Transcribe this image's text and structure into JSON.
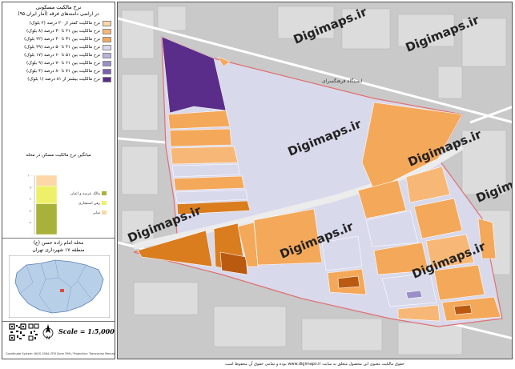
{
  "legend": {
    "title": "نرخ مالکیت مسکونی",
    "subtitle": "در اراضی دامنه‌های فرقه (آمار ایران ۹۵)",
    "classes": [
      {
        "label": "نرخ مالکیت کمتر از ۲۰ درصد (۲ بلوک)",
        "color": "#fcd8a8"
      },
      {
        "label": "نرخ مالکیت بین ۲۱ تا ۳۰ درصد (۸ بلوک)",
        "color": "#f7b877"
      },
      {
        "label": "نرخ مالکیت بین ۳۱ تا ۴۰ درصد (۲۲ بلوک)",
        "color": "#f4a85a"
      },
      {
        "label": "نرخ مالکیت بین ۴۱ تا ۵۰ درصد (۲۹ بلوک)",
        "color": "#d9d9ec"
      },
      {
        "label": "نرخ مالکیت بین ۵۱ تا ۶۰ درصد (۱۷ بلوک)",
        "color": "#b7b3d9"
      },
      {
        "label": "نرخ مالکیت بین ۶۱ تا ۷۰ درصد (۹ بلوک)",
        "color": "#9b8fc8"
      },
      {
        "label": "نرخ مالکیت بین ۷۱ تا ۸۰ درصد (۴ بلوک)",
        "color": "#7b5fb0"
      },
      {
        "label": "نرخ مالکیت بیشتر از ۸۱ درصد (۱ بلوک)",
        "color": "#5b2d8a"
      }
    ]
  },
  "chart_title": "میانگین نرخ مالکیت مسکن در محله",
  "chart_data": {
    "type": "bar",
    "categories": [
      "مالک عرصه و اعیان",
      "رهن استیجاری",
      "سایر"
    ],
    "values": [
      52,
      30,
      18
    ],
    "colors": [
      "#a8b23a",
      "#eef06a",
      "#fcd8a8"
    ],
    "ylim": [
      0,
      100
    ],
    "tick_labels": [
      "۰",
      "۲۰",
      "۴۰",
      "۶۰",
      "۸۰",
      "۱۰۰"
    ]
  },
  "neighborhood": {
    "title": "محله امام زاده حسن (ع)",
    "subtitle": "منطقه ۱۷ شهرداری تهران"
  },
  "scale": "Scale = 1:5,000",
  "north_label": "N",
  "coords_note": "Coordinate System: WGS 1984 UTM Zone 39N / Projection: Transverse Mercator",
  "map": {
    "watermarks": [
      "Digimaps.ir",
      "Digimaps.ir",
      "Digimaps.ir",
      "Digimaps.ir",
      "Digimaps.ir",
      "Digimaps.ir",
      "Digimaps.ir",
      "Digimaps.ir"
    ],
    "place_label": "ایستگاه فرهنگسرای"
  },
  "footer": "حقوق مالکیت معنوی این محصول متعلق به سایت www.digimaps.ir بوده و تمامی حقوق آن محفوظ است"
}
